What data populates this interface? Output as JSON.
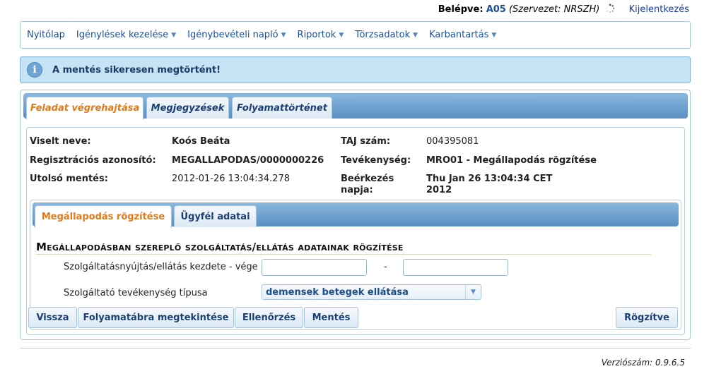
{
  "login": {
    "label": "Belépve:",
    "code": "A05",
    "organization": "(Szervezet: NRSZH)",
    "logout": "Kijelentkezés"
  },
  "menu": [
    {
      "label": "Nyitólap",
      "dropdown": false
    },
    {
      "label": "Igénylések kezelése",
      "dropdown": true
    },
    {
      "label": "Igénybevételi napló",
      "dropdown": true
    },
    {
      "label": "Riportok",
      "dropdown": true
    },
    {
      "label": "Törzsadatok",
      "dropdown": true
    },
    {
      "label": "Karbantartás",
      "dropdown": true
    }
  ],
  "notice": {
    "icon": "info-icon",
    "message": "A mentés sikeresen megtörtént!"
  },
  "tabs": [
    {
      "label": "Feladat végrehajtása",
      "active": true
    },
    {
      "label": "Megjegyzések",
      "active": false
    },
    {
      "label": "Folyamattörténet",
      "active": false
    }
  ],
  "details": {
    "name_label": "Viselt neve:",
    "name_value": "Koós Beáta",
    "reg_label": "Regisztrációs azonosító:",
    "reg_value": "MEGALLAPODAS/0000000226",
    "saved_label": "Utolsó mentés:",
    "saved_value": "2012-01-26 13:04:34.278",
    "taj_label": "TAJ szám:",
    "taj_value": "004395081",
    "activity_label": "Tevékenység:",
    "activity_value": "MRO01 - Megállapodás rögzítése",
    "arrival_label_1": "Beérkezés",
    "arrival_label_2": "napja:",
    "arrival_value_1": "Thu Jan 26 13:04:34 CET",
    "arrival_value_2": "2012"
  },
  "inner_tabs": [
    {
      "label": "Megállapodás rögzítése",
      "active": true
    },
    {
      "label": "Ügyfél adatai",
      "active": false
    }
  ],
  "form": {
    "section_title": "Megállapodásban szereplő szolgáltatás/ellátás adatainak rögzítése",
    "period_label": "Szolgáltatásnyújtás/ellátás kezdete - vége",
    "period_start": "",
    "period_separator": "-",
    "period_end": "",
    "type_label": "Szolgáltató tevékenység típusa",
    "type_value": "demensek betegek ellátása"
  },
  "buttons": {
    "back": "Vissza",
    "flowchart": "Folyamatábra megtekintése",
    "check": "Ellenőrzés",
    "save": "Mentés",
    "record": "Rögzítve"
  },
  "footer": {
    "version": "Verziószám: 0.9.6.5"
  }
}
